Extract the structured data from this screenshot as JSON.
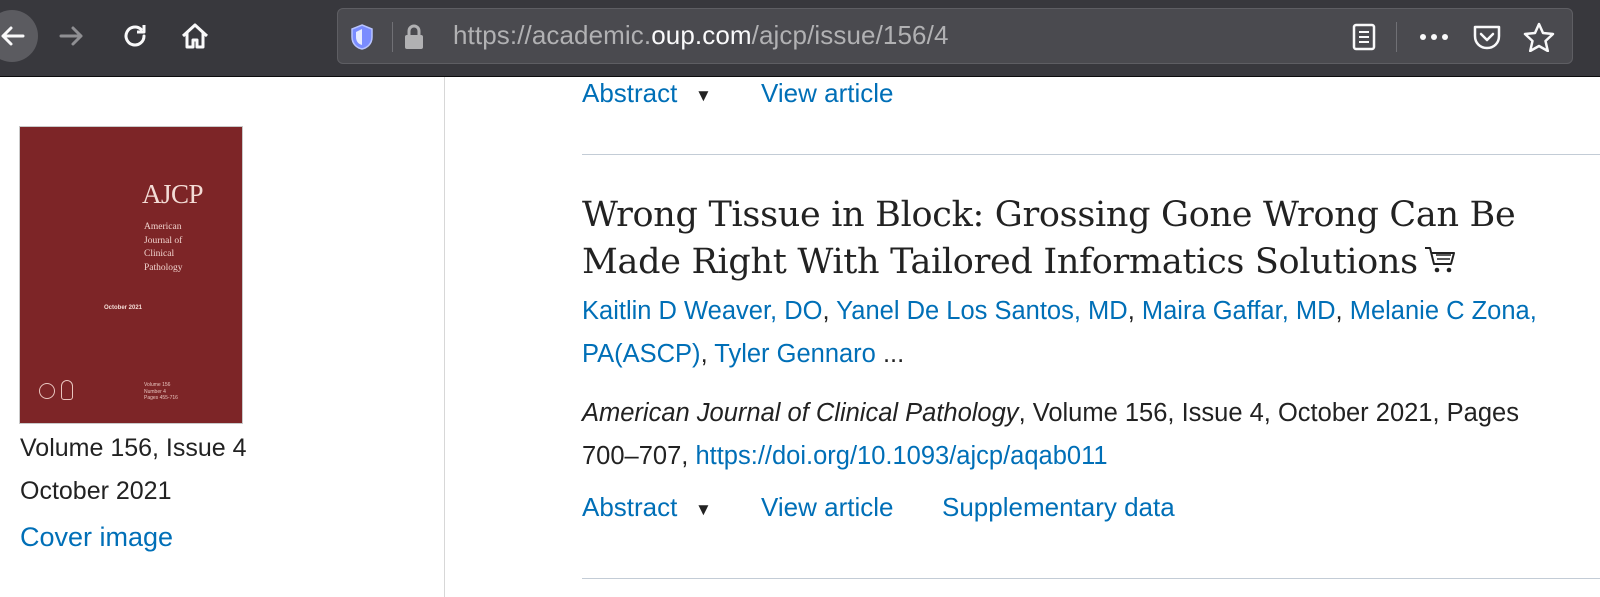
{
  "browser": {
    "url_prefix": "https://academic.",
    "url_host": "oup.com",
    "url_path": "/ajcp/issue/156/4"
  },
  "sidebar": {
    "cover": {
      "title": "AJCP",
      "subtitle_lines": [
        "American",
        "Journal of",
        "Clinical",
        "Pathology"
      ],
      "date": "October 2021",
      "volume_lines": [
        "Volume 156",
        "Number 4",
        "Pages 455-716"
      ]
    },
    "volume_issue": "Volume 156, Issue 4",
    "date": "October 2021",
    "cover_image_link": "Cover image"
  },
  "prev_article": {
    "abstract_label": "Abstract",
    "view_article_label": "View article"
  },
  "article": {
    "title": "Wrong Tissue in Block: Grossing Gone Wrong Can Be Made Right With Tailored Informatics Solutions",
    "authors": [
      "Kaitlin D Weaver, DO",
      "Yanel De Los Santos, MD",
      "Maira Gaffar, MD",
      "Melanie C Zona, PA(ASCP)",
      "Tyler Gennaro"
    ],
    "authors_more": "...",
    "journal": "American Journal of Clinical Pathology",
    "citation_rest": ", Volume 156, Issue 4, October 2021, Pages 700–707, ",
    "doi": "https://doi.org/10.1093/ajcp/aqab011",
    "abstract_label": "Abstract",
    "view_article_label": "View article",
    "supplementary_label": "Supplementary data"
  },
  "colors": {
    "link": "#006fb7",
    "toolbar_bg": "#38383d",
    "cover_bg": "#7d2527"
  }
}
